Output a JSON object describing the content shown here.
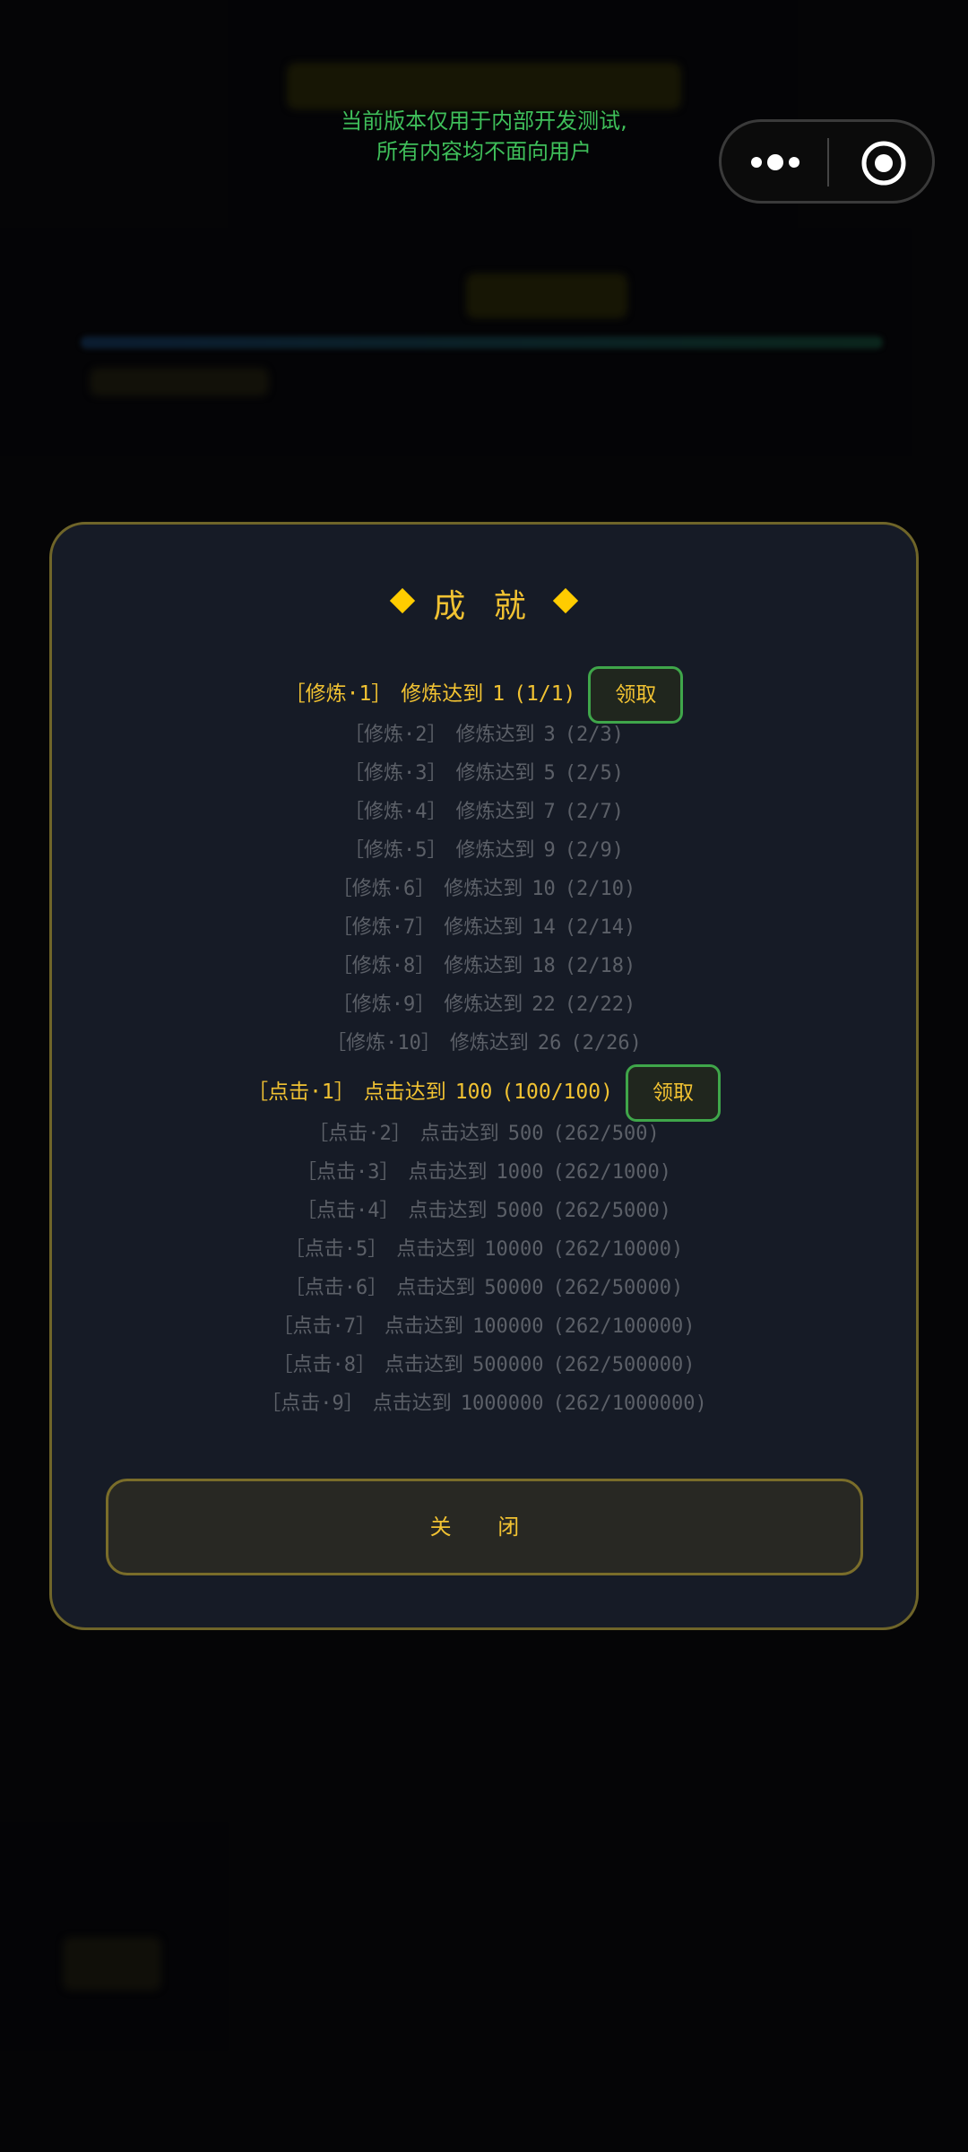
{
  "notice": {
    "line1": "当前版本仅用于内部开发测试,",
    "line2": "所有内容均不面向用户"
  },
  "capsule": {
    "more_icon": "more-dots-icon",
    "close_icon": "target-circle-icon"
  },
  "modal": {
    "title": "成 就",
    "claim_label": "领取",
    "close_label": "关 闭"
  },
  "achievements": [
    {
      "tag": "［修炼·1］",
      "desc": "修炼达到",
      "target": "1",
      "progress": "(1/1)",
      "claimable": true
    },
    {
      "tag": "［修炼·2］",
      "desc": "修炼达到",
      "target": "3",
      "progress": "(2/3)",
      "claimable": false
    },
    {
      "tag": "［修炼·3］",
      "desc": "修炼达到",
      "target": "5",
      "progress": "(2/5)",
      "claimable": false
    },
    {
      "tag": "［修炼·4］",
      "desc": "修炼达到",
      "target": "7",
      "progress": "(2/7)",
      "claimable": false
    },
    {
      "tag": "［修炼·5］",
      "desc": "修炼达到",
      "target": "9",
      "progress": "(2/9)",
      "claimable": false
    },
    {
      "tag": "［修炼·6］",
      "desc": "修炼达到",
      "target": "10",
      "progress": "(2/10)",
      "claimable": false
    },
    {
      "tag": "［修炼·7］",
      "desc": "修炼达到",
      "target": "14",
      "progress": "(2/14)",
      "claimable": false
    },
    {
      "tag": "［修炼·8］",
      "desc": "修炼达到",
      "target": "18",
      "progress": "(2/18)",
      "claimable": false
    },
    {
      "tag": "［修炼·9］",
      "desc": "修炼达到",
      "target": "22",
      "progress": "(2/22)",
      "claimable": false
    },
    {
      "tag": "［修炼·10］",
      "desc": "修炼达到",
      "target": "26",
      "progress": "(2/26)",
      "claimable": false
    },
    {
      "tag": "［点击·1］",
      "desc": "点击达到",
      "target": "100",
      "progress": "(100/100)",
      "claimable": true
    },
    {
      "tag": "［点击·2］",
      "desc": "点击达到",
      "target": "500",
      "progress": "(262/500)",
      "claimable": false
    },
    {
      "tag": "［点击·3］",
      "desc": "点击达到",
      "target": "1000",
      "progress": "(262/1000)",
      "claimable": false
    },
    {
      "tag": "［点击·4］",
      "desc": "点击达到",
      "target": "5000",
      "progress": "(262/5000)",
      "claimable": false
    },
    {
      "tag": "［点击·5］",
      "desc": "点击达到",
      "target": "10000",
      "progress": "(262/10000)",
      "claimable": false
    },
    {
      "tag": "［点击·6］",
      "desc": "点击达到",
      "target": "50000",
      "progress": "(262/50000)",
      "claimable": false
    },
    {
      "tag": "［点击·7］",
      "desc": "点击达到",
      "target": "100000",
      "progress": "(262/100000)",
      "claimable": false
    },
    {
      "tag": "［点击·8］",
      "desc": "点击达到",
      "target": "500000",
      "progress": "(262/500000)",
      "claimable": false
    },
    {
      "tag": "［点击·9］",
      "desc": "点击达到",
      "target": "1000000",
      "progress": "(262/1000000)",
      "claimable": false
    }
  ],
  "colors": {
    "accent": "#f1c232",
    "claim_border": "#3fa64a",
    "notice": "#3fbf5a",
    "dim_text": "#5c6068"
  }
}
